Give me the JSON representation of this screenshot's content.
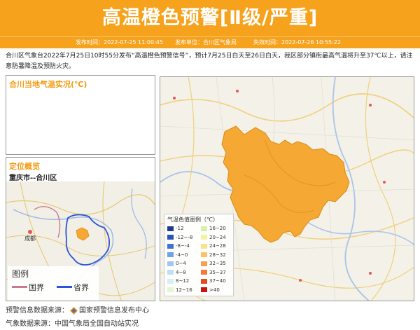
{
  "header": {
    "title": "高温橙色预警[Ⅱ级/严重]",
    "issue_time": "发布时间：2022-07-25 11:00:45",
    "issuer": "发布单位：合川区气象局",
    "expire_time": "失效时间：2022-07-26 10:55:22"
  },
  "description": "合川区气象台2022年7月25日10时55分发布“高温橙色预警信号”，预计7月25日白天至26日白天，我区部分镇街最高气温将升至37℃以上，请注意防暑降温及预防火灾。",
  "temp_panel": {
    "title": "合川当地气温实况(℃)"
  },
  "location_panel": {
    "title": "定位概览",
    "subtitle": "重庆市--合川区",
    "minimap_city": "成都",
    "legend_title": "图例",
    "legend_national": "国界",
    "legend_province": "省界"
  },
  "color_legend": {
    "title": "气温色值图例（℃）",
    "items": [
      {
        "label": "-12",
        "color": "#1f3a8a"
      },
      {
        "label": "16~20",
        "color": "#d8f0a8"
      },
      {
        "label": "-12~-8",
        "color": "#2854b5"
      },
      {
        "label": "20~24",
        "color": "#f3f4a0"
      },
      {
        "label": "-8~-4",
        "color": "#3f74d0"
      },
      {
        "label": "24~28",
        "color": "#fbe38a"
      },
      {
        "label": "-4~0",
        "color": "#6ea3e4"
      },
      {
        "label": "28~32",
        "color": "#fbc36b"
      },
      {
        "label": "0~4",
        "color": "#9fc8f0"
      },
      {
        "label": "32~35",
        "color": "#f9a04d"
      },
      {
        "label": "4~8",
        "color": "#bfe0f4"
      },
      {
        "label": "35~37",
        "color": "#f47a35"
      },
      {
        "label": "8~12",
        "color": "#d6eef4"
      },
      {
        "label": "37~40",
        "color": "#e84b1f"
      },
      {
        "label": "12~16",
        "color": "#e6f5d4"
      },
      {
        "label": ">40",
        "color": "#c8160e"
      }
    ]
  },
  "footer": {
    "warning_source_label": "预警信息数据来源：",
    "warning_source": "国家预警信息发布中心",
    "weather_source_label": "气象数据来源：",
    "weather_source": "中国气象局全国自动站实况"
  },
  "colors": {
    "accent": "#f6a21c",
    "region_fill": "#f5a833"
  }
}
